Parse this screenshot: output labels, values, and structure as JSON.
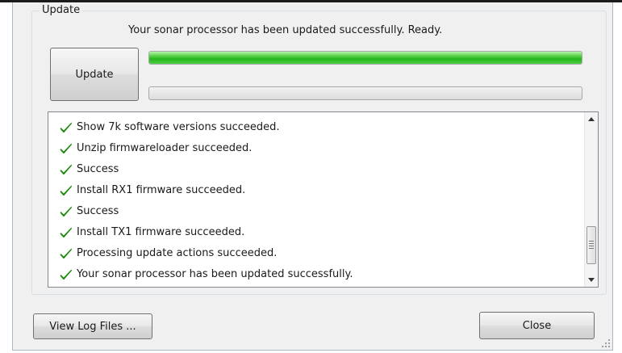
{
  "update_group": {
    "title": "Update",
    "status_text": "Your sonar processor has been updated successfully. Ready.",
    "update_button_label": "Update",
    "progress_primary": 1.0,
    "progress_secondary": 0.0,
    "progress_color": "#2bbd22"
  },
  "log": {
    "check_icon": "check-icon",
    "check_color": "#1f8a0f",
    "items": [
      "Show 7k software versions succeeded.",
      "Unzip firmwareloader succeeded.",
      "Success",
      "Install RX1 firmware succeeded.",
      "Success",
      "Install TX1 firmware succeeded.",
      "Processing update actions succeeded.",
      "Your sonar processor has been updated successfully."
    ]
  },
  "footer": {
    "view_log_label": "View Log Files ...",
    "close_label": "Close"
  }
}
